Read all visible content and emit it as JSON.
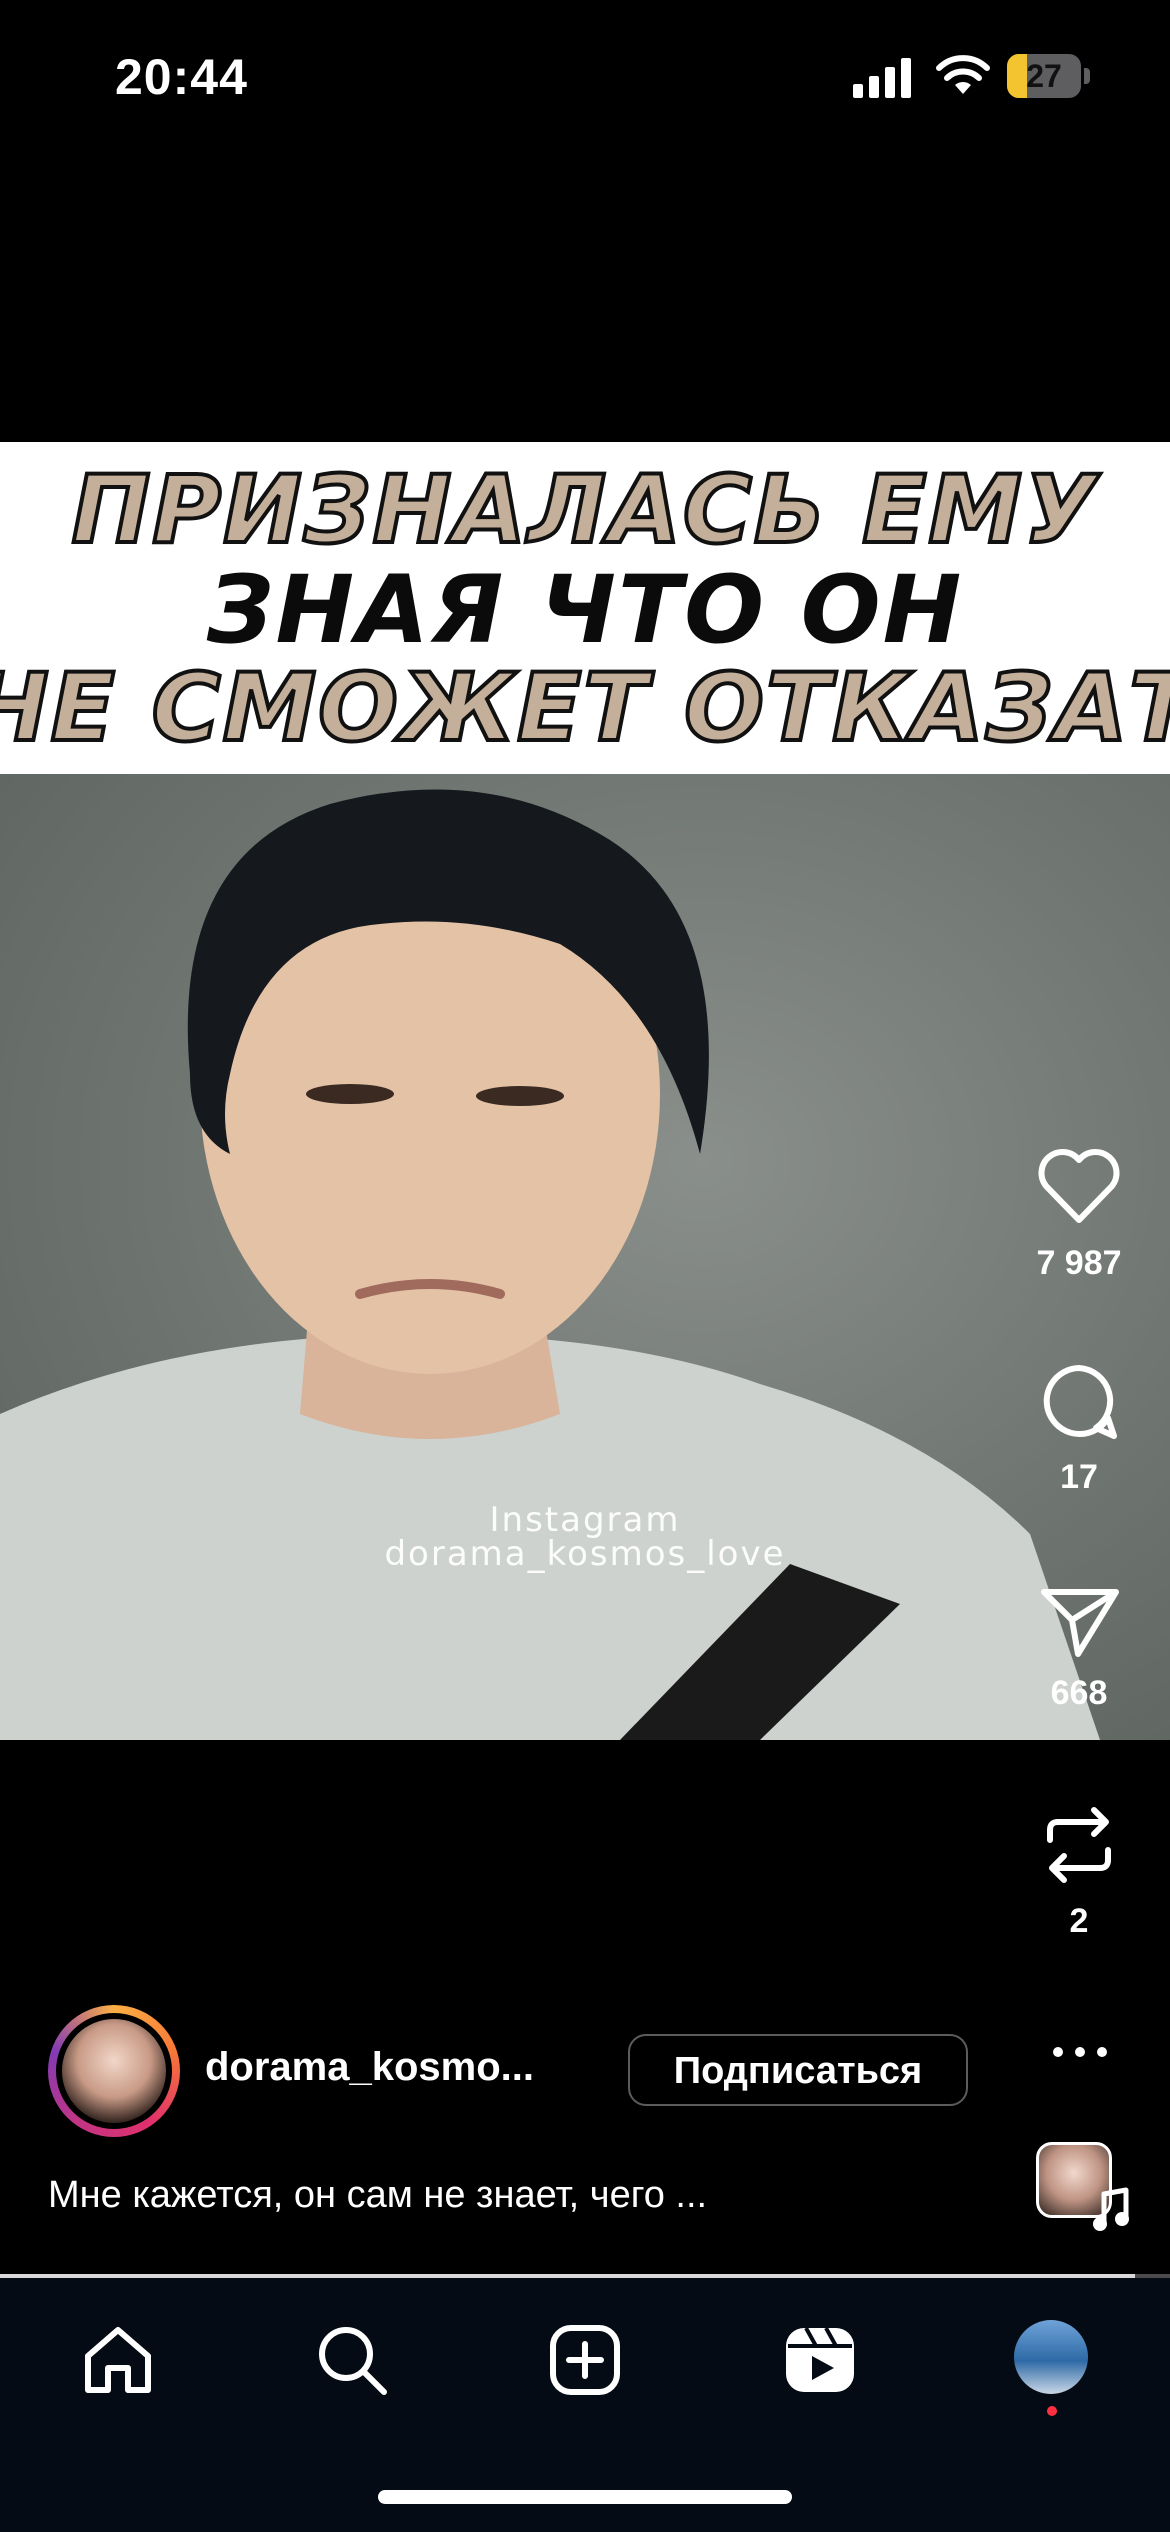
{
  "status_bar": {
    "time": "20:44",
    "battery_level": "27",
    "battery_fraction": 0.27
  },
  "video": {
    "banner_lines": [
      "ПРИЗНАЛАСЬ ЕМУ",
      "ЗНАЯ ЧТО ОН",
      "НЕ СМОЖЕТ ОТКАЗАТЬ"
    ],
    "watermark_line1": "Instagram",
    "watermark_line2": "dorama_kosmos_love",
    "progress_fraction": 0.97
  },
  "actions": {
    "likes": "7 987",
    "comments": "17",
    "shares": "668",
    "reposts": "2"
  },
  "post": {
    "username": "dorama_kosmo...",
    "follow_label": "Подписаться",
    "caption": "Мне кажется, он сам не знает, чего ..."
  },
  "tab_bar": {
    "items": [
      "home-icon",
      "search-icon",
      "create-icon",
      "reels-icon",
      "profile-avatar"
    ]
  },
  "colors": {
    "banner_beige": "#c4b09a",
    "story_ring_start": "#fcaf45",
    "story_ring_end": "#833ab4",
    "notification_dot": "#ff3040",
    "tab_bar_bg": "#050b14"
  }
}
